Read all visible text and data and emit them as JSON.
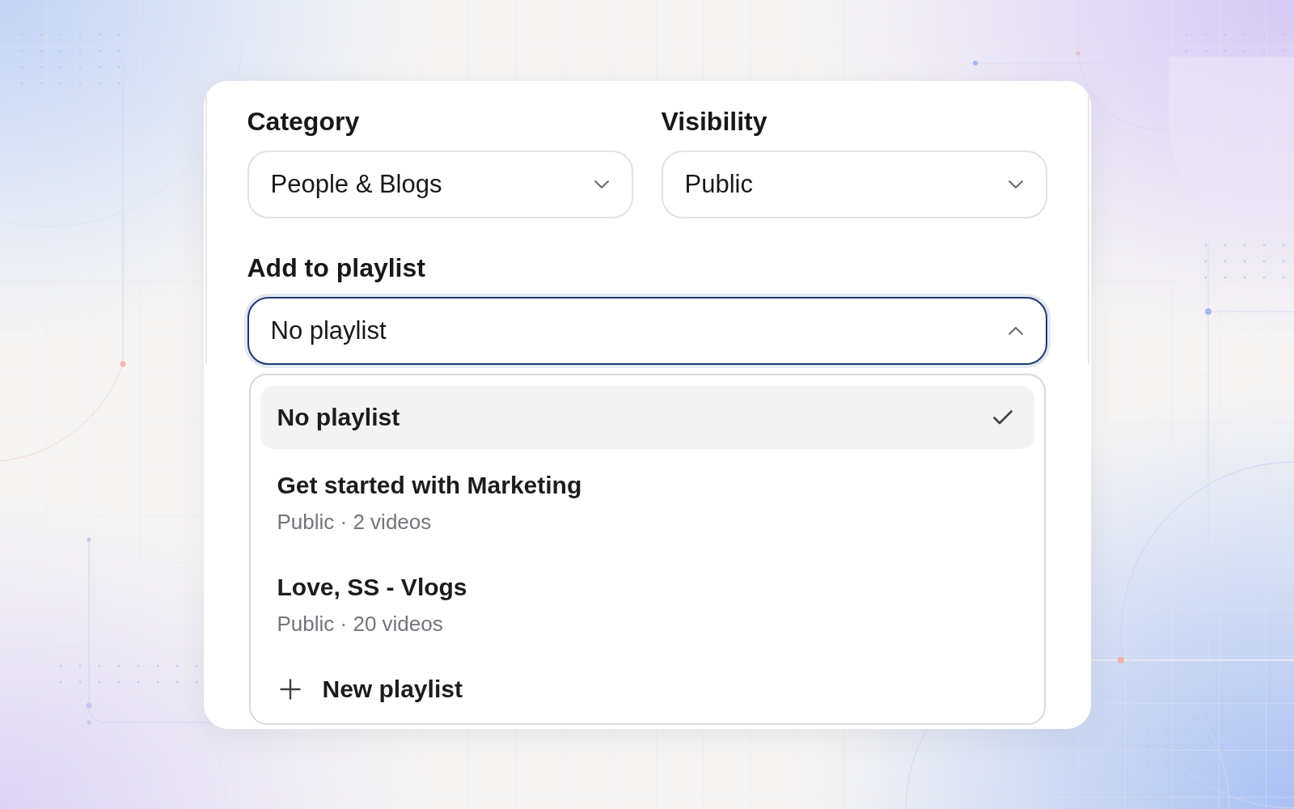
{
  "form": {
    "rows": [
      {
        "fields": [
          {
            "label": "Category",
            "value": "People & Blogs",
            "expanded": false
          },
          {
            "label": "Visibility",
            "value": "Public",
            "expanded": false
          }
        ]
      },
      {
        "fields": [
          {
            "label": "Add to playlist",
            "value": "No playlist",
            "expanded": true,
            "options": [
              {
                "kind": "option",
                "title": "No playlist",
                "selected": true
              },
              {
                "kind": "option",
                "title": "Get started with Marketing",
                "subtitle": "Public · 2 videos",
                "selected": false
              },
              {
                "kind": "option",
                "title": "Love, SS - Vlogs",
                "subtitle": "Public · 20 videos",
                "selected": false
              },
              {
                "kind": "action",
                "title": "New playlist",
                "selected": false
              }
            ]
          }
        ]
      }
    ]
  }
}
